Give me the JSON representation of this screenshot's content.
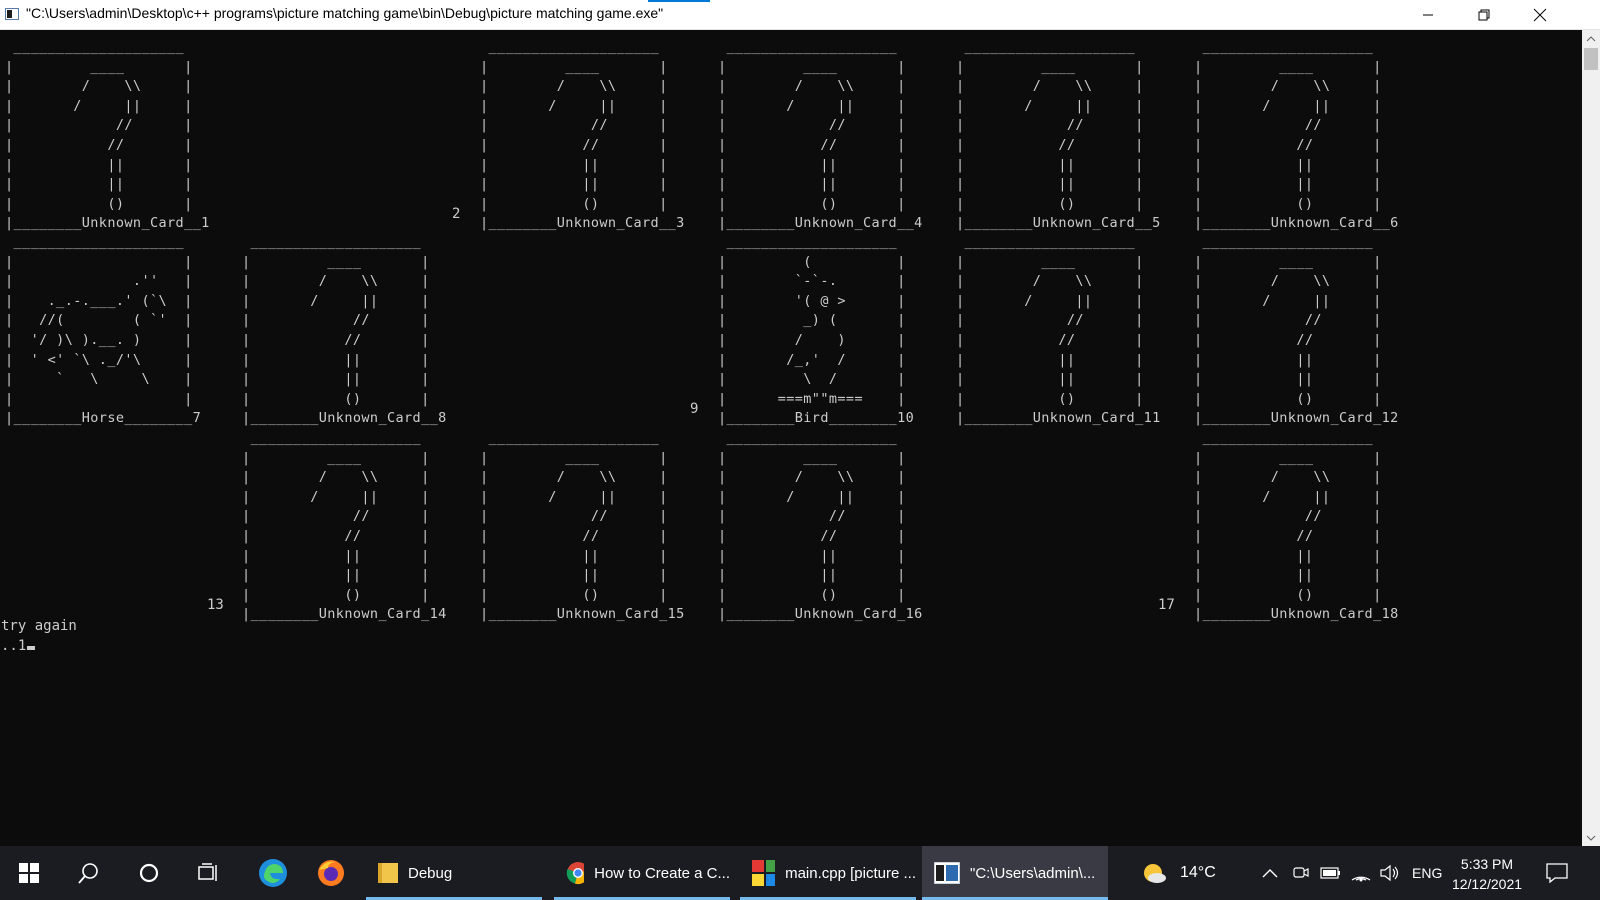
{
  "window": {
    "title": "\"C:\\Users\\admin\\Desktop\\c++ programs\\picture matching game\\bin\\Debug\\picture matching game.exe\""
  },
  "console": {
    "cards": [
      {
        "row": 1,
        "col": 1,
        "art": " ____________________\n|         ____       |\n|        /    \\\\     |\n|       /     ||     |\n|            //      |\n|           //       |\n|           ||       |\n|           ||       |\n|           ()       |\n|________Unknown_Card__1"
      },
      {
        "row": 1,
        "col": 3,
        "art": " ____________________\n|         ____       |\n|        /    \\\\     |\n|       /     ||     |\n|            //      |\n|           //       |\n|           ||       |\n|           ||       |\n|           ()       |\n|________Unknown_Card__3"
      },
      {
        "row": 1,
        "col": 4,
        "art": " ____________________\n|         ____       |\n|        /    \\\\     |\n|       /     ||     |\n|            //      |\n|           //       |\n|           ||       |\n|           ||       |\n|           ()       |\n|________Unknown_Card__4"
      },
      {
        "row": 1,
        "col": 5,
        "art": " ____________________\n|         ____       |\n|        /    \\\\     |\n|       /     ||     |\n|            //      |\n|           //       |\n|           ||       |\n|           ||       |\n|           ()       |\n|________Unknown_Card__5"
      },
      {
        "row": 1,
        "col": 6,
        "art": " ____________________\n|         ____       |\n|        /    \\\\     |\n|       /     ||     |\n|            //      |\n|           //       |\n|           ||       |\n|           ||       |\n|           ()       |\n|________Unknown_Card__6"
      },
      {
        "row": 2,
        "col": 1,
        "art": " ____________________\n|                    |\n|              .''   |\n|    ._.-.___.' (`\\  |\n|   //(        ( `'  |\n|  '/ )\\ ).__. )     |\n|  ' <' `\\ ._/'\\     |\n|     `   \\     \\    |\n|                    |\n|________Horse________7"
      },
      {
        "row": 2,
        "col": 2,
        "art": " ____________________\n|         ____       |\n|        /    \\\\     |\n|       /     ||     |\n|            //      |\n|           //       |\n|           ||       |\n|           ||       |\n|           ()       |\n|________Unknown_Card__8"
      },
      {
        "row": 2,
        "col": 4,
        "art": " ____________________\n|         (          |\n|        `-`-.       |\n|        '( @ >      |\n|         _) (       |\n|        /    )      |\n|       /_,'  /      |\n|         \\  /       |\n|      ===m\"\"m===    |\n|________Bird________10"
      },
      {
        "row": 2,
        "col": 5,
        "art": " ____________________\n|         ____       |\n|        /    \\\\     |\n|       /     ||     |\n|            //      |\n|           //       |\n|           ||       |\n|           ||       |\n|           ()       |\n|________Unknown_Card_11"
      },
      {
        "row": 2,
        "col": 6,
        "art": " ____________________\n|         ____       |\n|        /    \\\\     |\n|       /     ||     |\n|            //      |\n|           //       |\n|           ||       |\n|           ||       |\n|           ()       |\n|________Unknown_Card_12"
      },
      {
        "row": 3,
        "col": 2,
        "art": " ____________________\n|         ____       |\n|        /    \\\\     |\n|       /     ||     |\n|            //      |\n|           //       |\n|           ||       |\n|           ||       |\n|           ()       |\n|________Unknown_Card_14"
      },
      {
        "row": 3,
        "col": 3,
        "art": " ____________________\n|         ____       |\n|        /    \\\\     |\n|       /     ||     |\n|            //      |\n|           //       |\n|           ||       |\n|           ||       |\n|           ()       |\n|________Unknown_Card_15"
      },
      {
        "row": 3,
        "col": 4,
        "art": " ____________________\n|         ____       |\n|        /    \\\\     |\n|       /     ||     |\n|            //      |\n|           //       |\n|           ||       |\n|           ||       |\n|           ()       |\n|________Unknown_Card_16"
      },
      {
        "row": 3,
        "col": 6,
        "art": " ____________________\n|         ____       |\n|        /    \\\\     |\n|       /     ||     |\n|            //      |\n|           //       |\n|           ||       |\n|           ||       |\n|           ()       |\n|________Unknown_Card_18"
      }
    ],
    "matched_slots": [
      {
        "row": 1,
        "col": 2,
        "number": "2"
      },
      {
        "row": 2,
        "col": 3,
        "number": "9"
      },
      {
        "row": 3,
        "col": 1,
        "number": "13"
      },
      {
        "row": 3,
        "col": 5,
        "number": "17"
      }
    ],
    "message": "try again",
    "prompt": "..1"
  },
  "taskbar": {
    "apps": [
      {
        "label": "Debug",
        "icon": "folder-icon",
        "active": false
      },
      {
        "label": "How to Create a C...",
        "icon": "chrome-icon",
        "active": false
      },
      {
        "label": "main.cpp [picture ...",
        "icon": "codeblocks-icon",
        "active": false
      },
      {
        "label": "\"C:\\Users\\admin\\...",
        "icon": "console-icon",
        "active": true
      }
    ],
    "weather": "14°C",
    "language": "ENG",
    "time": "5:33 PM",
    "date": "12/12/2021"
  }
}
